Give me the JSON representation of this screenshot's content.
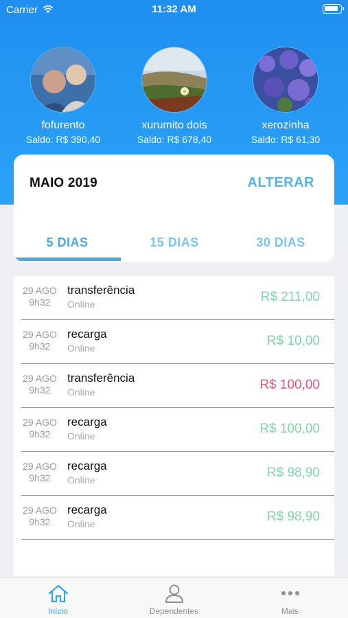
{
  "status_bar": {
    "carrier": "Carrier",
    "time": "11:32 AM"
  },
  "dependents": [
    {
      "name": "fofurento",
      "balance": "Saldo: R$ 390,40"
    },
    {
      "name": "xurumito dois",
      "balance": "Saldo: R$ 678,40"
    },
    {
      "name": "xerozinha",
      "balance": "Saldo: R$ 61,30"
    }
  ],
  "period": {
    "month_label": "MAIO 2019",
    "change_label": "ALTERAR"
  },
  "filter_tabs": [
    {
      "label": "5 DIAS",
      "active": true
    },
    {
      "label": "15 DIAS",
      "active": false
    },
    {
      "label": "30 DIAS",
      "active": false
    }
  ],
  "transactions": [
    {
      "day": "29 AGO",
      "time": "9h32",
      "title": "transferência",
      "channel": "Online",
      "amount": "R$ 211,00",
      "color": "#7fd8a4"
    },
    {
      "day": "29 AGO",
      "time": "9h32",
      "title": "recarga",
      "channel": "Online",
      "amount": "R$ 10,00",
      "color": "#7fd8a4"
    },
    {
      "day": "29 AGO",
      "time": "9h32",
      "title": "transferência",
      "channel": "Online",
      "amount": "R$ 100,00",
      "color": "#e5557f"
    },
    {
      "day": "29 AGO",
      "time": "9h32",
      "title": "recarga",
      "channel": "Online",
      "amount": "R$ 100,00",
      "color": "#7fd8a4"
    },
    {
      "day": "29 AGO",
      "time": "9h32",
      "title": "recarga",
      "channel": "Online",
      "amount": "R$ 98,90",
      "color": "#7fd8a4"
    },
    {
      "day": "29 AGO",
      "time": "9h32",
      "title": "recarga",
      "channel": "Online",
      "amount": "R$ 98,90",
      "color": "#7fd8a4"
    }
  ],
  "tab_bar": [
    {
      "label": "Início",
      "icon": "home-icon",
      "active": true
    },
    {
      "label": "Dependentes",
      "icon": "person-icon",
      "active": false
    },
    {
      "label": "Mais",
      "icon": "more-dots-icon",
      "active": false
    }
  ],
  "colors": {
    "header_blue": "#1f8ff0",
    "accent": "#4aa6e3",
    "positive": "#7fd8a4",
    "negative": "#e5557f"
  }
}
